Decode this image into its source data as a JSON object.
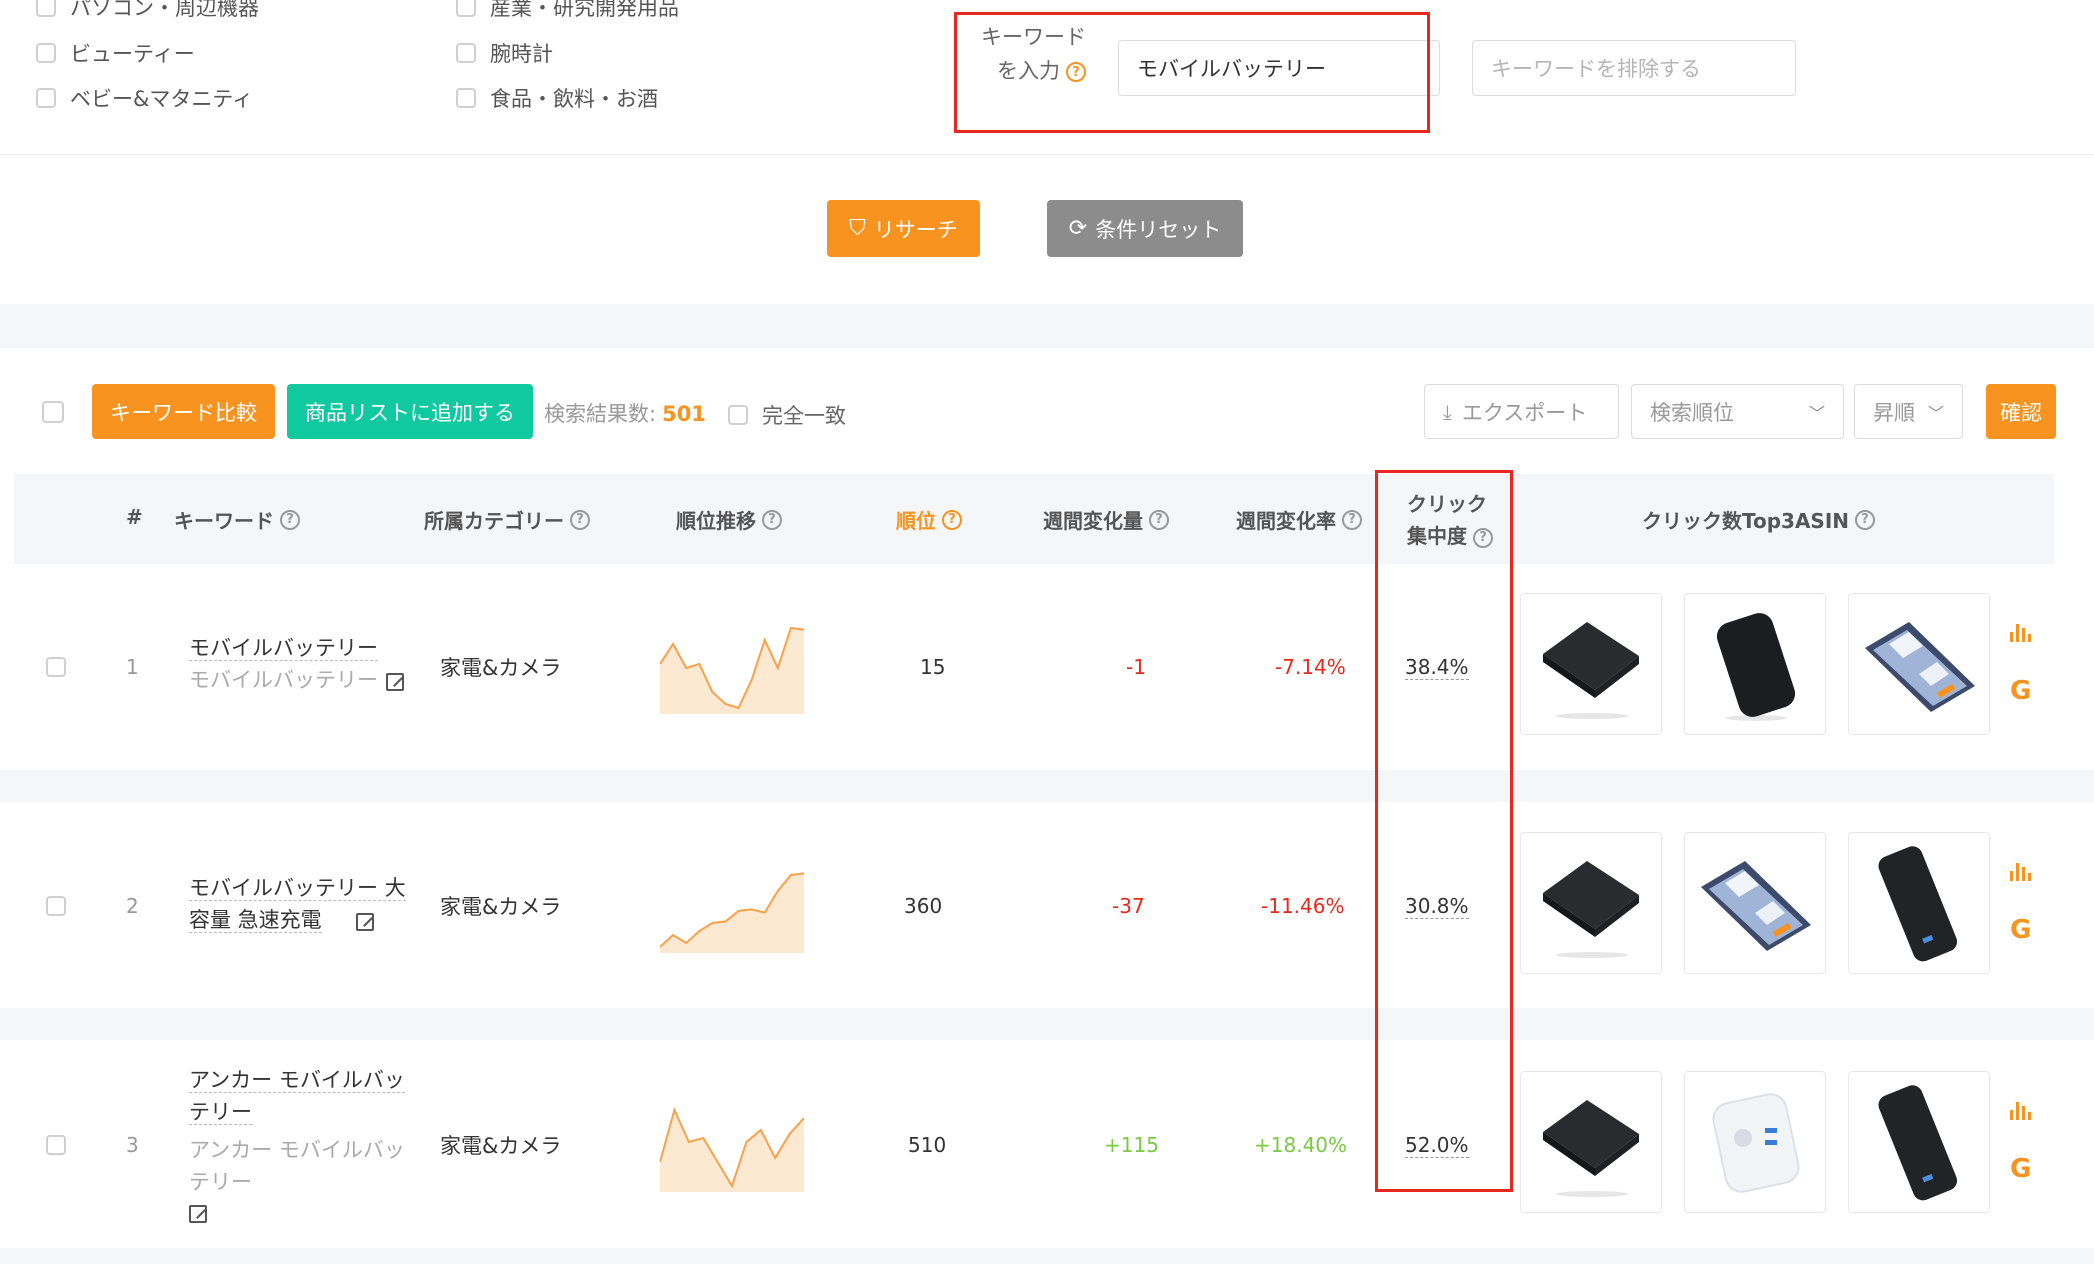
{
  "filters": {
    "categories_col1": [
      "パソコン・周辺機器",
      "ビューティー",
      "ベビー&マタニティ"
    ],
    "categories_col2": [
      "産業・研究開発用品",
      "腕時計",
      "食品・飲料・お酒"
    ],
    "keyword_label": "キーワードを入力",
    "keyword_value": "モバイルバッテリー",
    "exclude_placeholder": "キーワードを排除する"
  },
  "actions": {
    "research": "リサーチ",
    "reset": "条件リセット"
  },
  "toolbar": {
    "compare": "キーワード比較",
    "add_list": "商品リストに追加する",
    "result_label": "検索結果数:",
    "result_count": "501",
    "exact": "完全一致",
    "export": "エクスポート",
    "sort_field": "検索順位",
    "sort_order": "昇順",
    "confirm": "確認"
  },
  "table": {
    "headers": {
      "index": "#",
      "keyword": "キーワード",
      "category": "所属カテゴリー",
      "trend": "順位推移",
      "rank": "順位",
      "weekly_change": "週間変化量",
      "weekly_rate": "週間変化率",
      "click_conc_1": "クリック",
      "click_conc_2": "集中度",
      "top3": "クリック数Top3ASIN"
    },
    "rows": [
      {
        "index": "1",
        "keyword": "モバイルバッテリー",
        "sub": "モバイルバッテリー",
        "category": "家電&カメラ",
        "rank": "15",
        "change": "-1",
        "rate": "-7.14%",
        "conc": "38.4%",
        "spark": [
          0.55,
          0.8,
          0.5,
          0.55,
          0.2,
          0.05,
          0.0,
          0.35,
          0.85,
          0.5,
          1.0,
          0.98
        ]
      },
      {
        "index": "2",
        "keyword": "モバイルバッテリー 大容量 急速充電",
        "sub": "",
        "category": "家電&カメラ",
        "rank": "360",
        "change": "-37",
        "rate": "-11.46%",
        "conc": "30.8%",
        "spark": [
          0.0,
          0.15,
          0.05,
          0.2,
          0.3,
          0.32,
          0.45,
          0.47,
          0.43,
          0.7,
          0.9,
          0.92
        ]
      },
      {
        "index": "3",
        "keyword": "アンカー モバイルバッテリー",
        "sub": "アンカー モバイルバッテリー",
        "category": "家電&カメラ",
        "rank": "510",
        "change": "+115",
        "rate": "+18.40%",
        "conc": "52.0%",
        "spark": [
          0.3,
          0.95,
          0.55,
          0.6,
          0.3,
          0.0,
          0.55,
          0.7,
          0.35,
          0.65,
          0.85
        ]
      }
    ]
  },
  "colors": {
    "accent": "#f7931e",
    "teal": "#10c9a0",
    "negative": "#e8281e",
    "positive": "#7ac943",
    "highlight": "#e8281e"
  }
}
